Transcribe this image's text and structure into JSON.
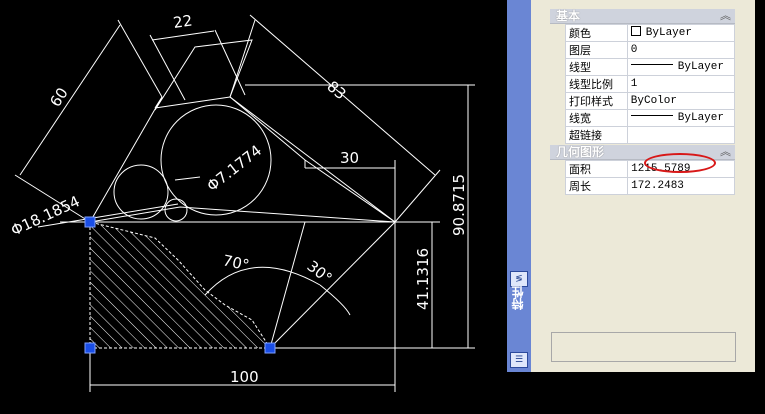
{
  "drawing": {
    "dimensions": {
      "top_width": "22",
      "slant_length": "60",
      "hyp_length": "83",
      "small_circle": "Φ18.1854",
      "mid_circle": "Φ7.1774",
      "inner_width": "30",
      "height_total": "90.8715",
      "height_right": "41.1316",
      "angle_left": "70°",
      "angle_right": "30°",
      "base_width": "100"
    },
    "colors": {
      "background": "#000000",
      "lines": "#ffffff",
      "grips": "#1a4ee6"
    }
  },
  "properties_palette": {
    "title": "特性",
    "sections": {
      "basic": {
        "title": "基本",
        "rows": [
          {
            "name": "颜色",
            "value": "ByLayer",
            "kind": "color"
          },
          {
            "name": "图层",
            "value": "0",
            "kind": "text"
          },
          {
            "name": "线型",
            "value": "ByLayer",
            "kind": "linetype"
          },
          {
            "name": "线型比例",
            "value": "1",
            "kind": "text"
          },
          {
            "name": "打印样式",
            "value": "ByColor",
            "kind": "text"
          },
          {
            "name": "线宽",
            "value": "ByLayer",
            "kind": "linetype"
          },
          {
            "name": "超链接",
            "value": "",
            "kind": "text"
          }
        ]
      },
      "geometry": {
        "title": "几何图形",
        "rows": [
          {
            "name": "面积",
            "value": "1215.5789"
          },
          {
            "name": "周长",
            "value": "172.2483"
          }
        ]
      }
    },
    "highlight_color": "#d81818"
  }
}
